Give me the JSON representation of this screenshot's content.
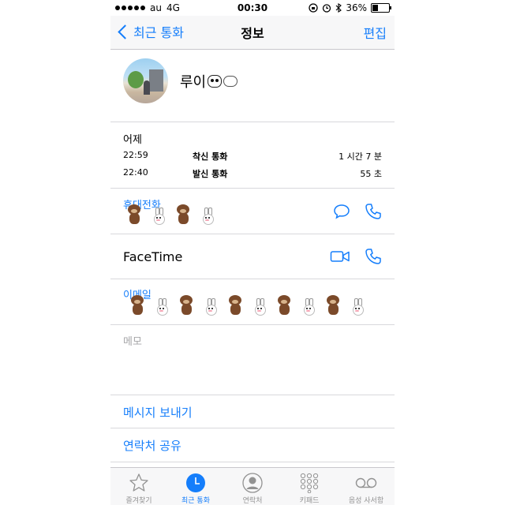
{
  "status_bar": {
    "carrier": "au",
    "network": "4G",
    "time": "00:30",
    "battery_percent": "36%",
    "battery_level": 0.36
  },
  "nav": {
    "back_label": "최근 통화",
    "title": "정보",
    "edit_label": "편집"
  },
  "contact": {
    "name": "루이"
  },
  "call_log": {
    "date": "어제",
    "entries": [
      {
        "time": "22:59",
        "type": "착신 통화",
        "duration": "1 시간 7 분"
      },
      {
        "time": "22:40",
        "type": "발신 통화",
        "duration": "55 초"
      }
    ]
  },
  "fields": {
    "mobile_label": "휴대전화",
    "facetime_label": "FaceTime",
    "email_label": "이메일",
    "memo_label": "메모"
  },
  "actions": {
    "send_message": "메시지 보내기",
    "share_contact": "연락처 공유"
  },
  "tabs": [
    {
      "label": "즐겨찾기",
      "icon": "star-icon",
      "active": false
    },
    {
      "label": "최근 통화",
      "icon": "clock-icon",
      "active": true
    },
    {
      "label": "연락처",
      "icon": "person-icon",
      "active": false
    },
    {
      "label": "키패드",
      "icon": "keypad-icon",
      "active": false
    },
    {
      "label": "음성 사서함",
      "icon": "voicemail-icon",
      "active": false
    }
  ],
  "colors": {
    "accent": "#157efb",
    "separator": "#d8d8dc",
    "muted": "#929292"
  }
}
